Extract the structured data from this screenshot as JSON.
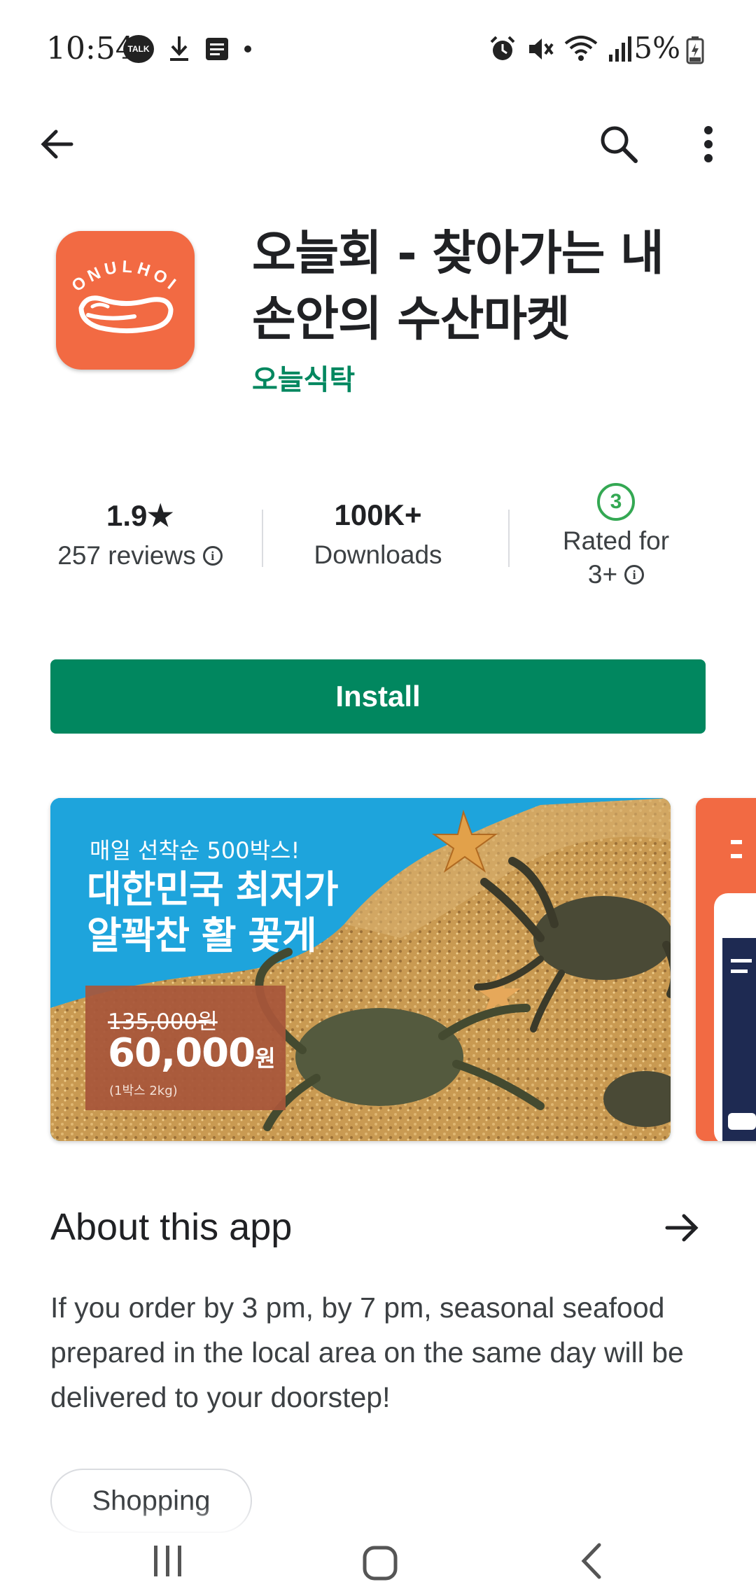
{
  "status_bar": {
    "time": "10:54",
    "talk_badge": "TALK",
    "battery_percent": "5%",
    "icons_left": [
      "talk-icon",
      "download-icon",
      "news-icon",
      "dot-icon"
    ],
    "icons_right": [
      "alarm-icon",
      "mute-icon",
      "wifi-icon",
      "signal-icon",
      "battery-icon"
    ]
  },
  "app": {
    "title": "오늘회 - 찾아가는 내 손안의 수산마켓",
    "developer": "오늘식탁",
    "icon_text": "ONULHOI",
    "icon_color": "#f26a43"
  },
  "stats": {
    "rating_value": "1.9★",
    "rating_label": "257 reviews",
    "downloads_value": "100K+",
    "downloads_label": "Downloads",
    "content_rating_badge": "3",
    "content_rating_label_line1": "Rated for",
    "content_rating_label_line2": "3+"
  },
  "install_label": "Install",
  "screenshots": {
    "shot1": {
      "subtitle": "매일 선착순 500박스!",
      "headline_line1": "대한민국 최저가",
      "headline_line2": "알꽉찬 활 꽃게",
      "price_old": "135,000원",
      "price_new": "60,000",
      "price_unit": "원",
      "price_note": "(1박스 2kg)"
    }
  },
  "about": {
    "title": "About this app",
    "description": "If you order by 3 pm, by 7 pm, seasonal seafood prepared in the local area on the same day will be delivered to your doorstep!",
    "category_chip": "Shopping"
  },
  "colors": {
    "accent_green": "#01875f",
    "rating_green": "#34a853",
    "brand_orange": "#f26a43"
  }
}
